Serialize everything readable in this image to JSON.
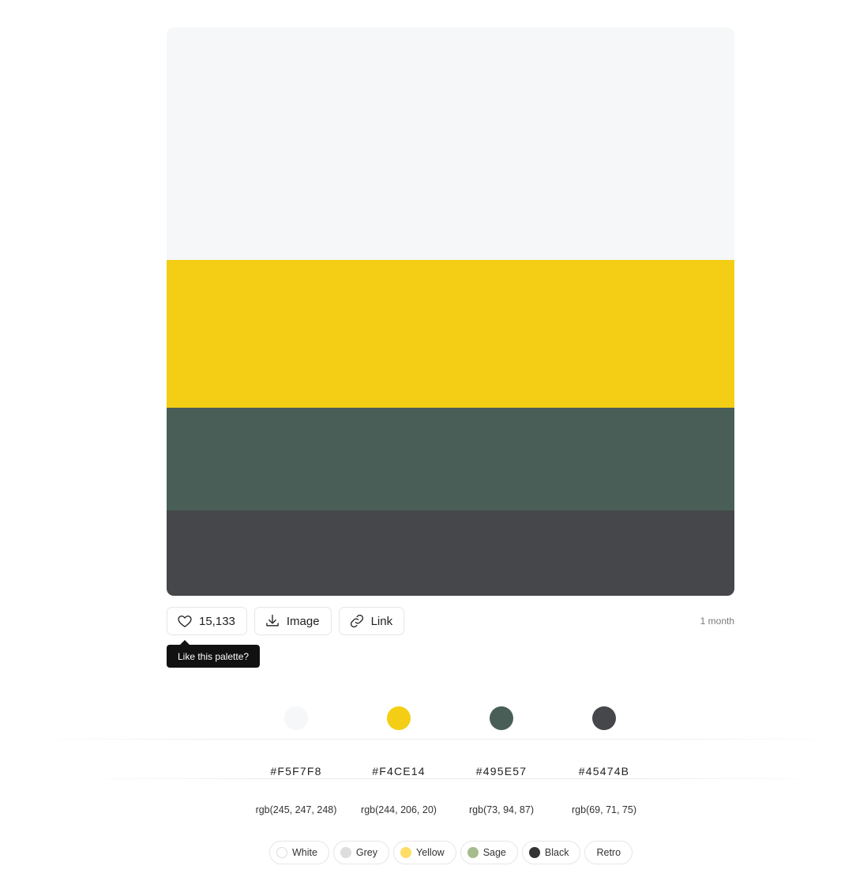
{
  "palette": {
    "swatches": [
      {
        "hex": "#F5F7F8",
        "rgb": "rgb(245, 247, 248)"
      },
      {
        "hex": "#F4CE14",
        "rgb": "rgb(244, 206, 20)"
      },
      {
        "hex": "#495E57",
        "rgb": "rgb(73, 94, 87)"
      },
      {
        "hex": "#45474B",
        "rgb": "rgb(69, 71, 75)"
      }
    ]
  },
  "actions": {
    "like_count": "15,133",
    "image_label": "Image",
    "link_label": "Link",
    "tooltip": "Like this palette?",
    "time_ago": "1 month",
    "icons": {
      "like": "heart-icon",
      "image": "download-icon",
      "link": "link-icon"
    }
  },
  "tags": [
    {
      "label": "White",
      "color": "#FFFFFF"
    },
    {
      "label": "Grey",
      "color": "#DDDDDD"
    },
    {
      "label": "Yellow",
      "color": "#FFDD66"
    },
    {
      "label": "Sage",
      "color": "#A6BC8C"
    },
    {
      "label": "Black",
      "color": "#333333"
    },
    {
      "label": "Retro",
      "color": null
    }
  ]
}
